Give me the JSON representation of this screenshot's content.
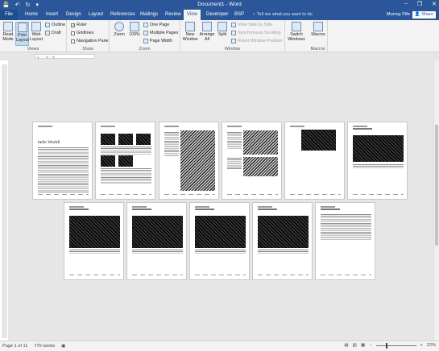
{
  "window": {
    "title": "Document1 - Word",
    "qat_save": "💾",
    "qat_undo": "↶",
    "qat_redo": "↻",
    "qat_more": "▾",
    "minimize": "–",
    "restore": "❐",
    "close": "✕"
  },
  "tabs": {
    "file": "File",
    "items": [
      "Home",
      "Insert",
      "Design",
      "Layout",
      "References",
      "Mailings",
      "Review",
      "View",
      "Developer",
      "BSP"
    ],
    "active": "View",
    "tell_me": "Tell me what you want to do",
    "user": "Murray Fife",
    "share": "Share"
  },
  "ribbon": {
    "views": {
      "label": "Views",
      "read_mode": "Read Mode",
      "print_layout": "Print Layout",
      "web_layout": "Web Layout",
      "outline": "Outline",
      "draft": "Draft"
    },
    "show": {
      "label": "Show",
      "ruler": "Ruler",
      "ruler_checked": true,
      "gridlines": "Gridlines",
      "gridlines_checked": false,
      "navigation_pane": "Navigation Pane",
      "navigation_pane_checked": false
    },
    "zoom": {
      "label": "Zoom",
      "zoom": "Zoom",
      "hundred": "100%",
      "one_page": "One Page",
      "multiple_pages": "Multiple Pages",
      "page_width": "Page Width"
    },
    "window": {
      "label": "Window",
      "new_window": "New Window",
      "arrange_all": "Arrange All",
      "split": "Split",
      "view_side_by_side": "View Side by Side",
      "synchronous_scrolling": "Synchronous Scrolling",
      "reset_window_position": "Reset Window Position",
      "switch_windows": "Switch Windows"
    },
    "macros": {
      "label": "Macros",
      "macros": "Macros"
    }
  },
  "ruler": {
    "marks": "· 2 · · · 4 · · 6 ·"
  },
  "document": {
    "heading": "hello World!"
  },
  "status": {
    "page": "Page 1 of 11",
    "words": "770 words",
    "zoom": "22%",
    "zoom_minus": "−",
    "zoom_plus": "+"
  }
}
